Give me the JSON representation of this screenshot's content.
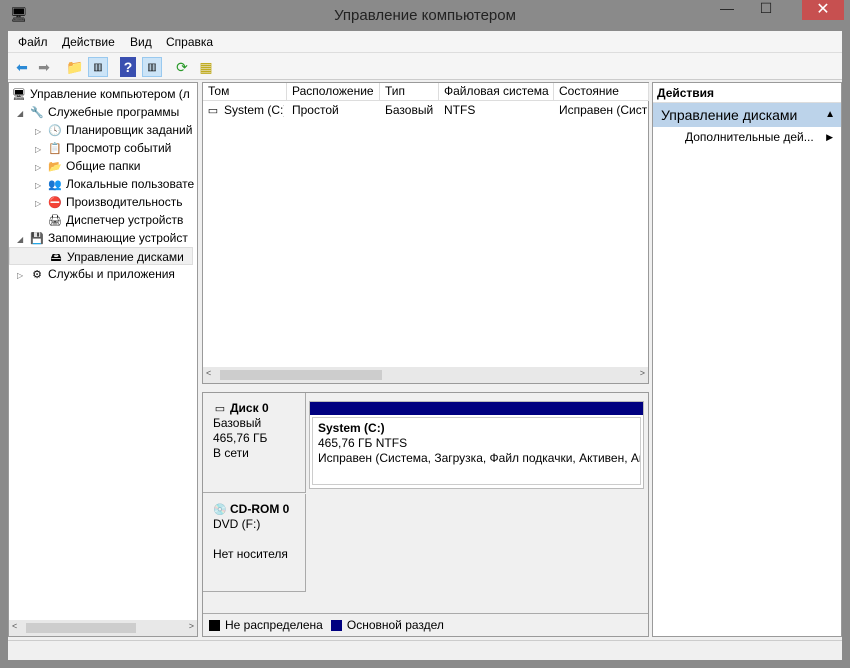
{
  "window": {
    "title": "Управление компьютером",
    "minimize": "—",
    "maximize": "☐",
    "close": "✕"
  },
  "menu": [
    "Файл",
    "Действие",
    "Вид",
    "Справка"
  ],
  "tree": {
    "root": "Управление компьютером (л",
    "items": [
      {
        "label": "Служебные программы",
        "level": 1,
        "exp": "◢",
        "icon": "tools-icon"
      },
      {
        "label": "Планировщик заданий",
        "level": 2,
        "exp": "▷",
        "icon": "clock-icon"
      },
      {
        "label": "Просмотр событий",
        "level": 2,
        "exp": "▷",
        "icon": "event-viewer-icon"
      },
      {
        "label": "Общие папки",
        "level": 2,
        "exp": "▷",
        "icon": "shared-folder-icon"
      },
      {
        "label": "Локальные пользовате",
        "level": 2,
        "exp": "▷",
        "icon": "users-icon"
      },
      {
        "label": "Производительность",
        "level": 2,
        "exp": "▷",
        "icon": "performance-icon"
      },
      {
        "label": "Диспетчер устройств",
        "level": 2,
        "exp": "",
        "icon": "device-manager-icon"
      },
      {
        "label": "Запоминающие устройст",
        "level": 1,
        "exp": "◢",
        "icon": "storage-icon"
      },
      {
        "label": "Управление дисками",
        "level": 2,
        "exp": "",
        "icon": "disk-management-icon",
        "selected": true
      },
      {
        "label": "Службы и приложения",
        "level": 1,
        "exp": "▷",
        "icon": "services-icon"
      }
    ]
  },
  "volumes": {
    "columns": [
      "Том",
      "Расположение",
      "Тип",
      "Файловая система",
      "Состояние"
    ],
    "rows": [
      [
        "System (C:)",
        "Простой",
        "Базовый",
        "NTFS",
        "Исправен (Сист"
      ]
    ]
  },
  "disks": [
    {
      "name": "Диск 0",
      "type": "Базовый",
      "size": "465,76 ГБ",
      "status": "В сети"
    },
    {
      "name": "CD-ROM 0",
      "type": "DVD (F:)",
      "status": "Нет носителя"
    }
  ],
  "partition": {
    "name": "System  (C:)",
    "size": "465,76 ГБ NTFS",
    "status": "Исправен (Система, Загрузка, Файл подкачки, Активен, Ав"
  },
  "legend": [
    {
      "label": "Не распределена",
      "color": "#000000"
    },
    {
      "label": "Основной раздел",
      "color": "#000080"
    }
  ],
  "actions": {
    "header": "Действия",
    "section": "Управление дисками",
    "item": "Дополнительные дей..."
  }
}
